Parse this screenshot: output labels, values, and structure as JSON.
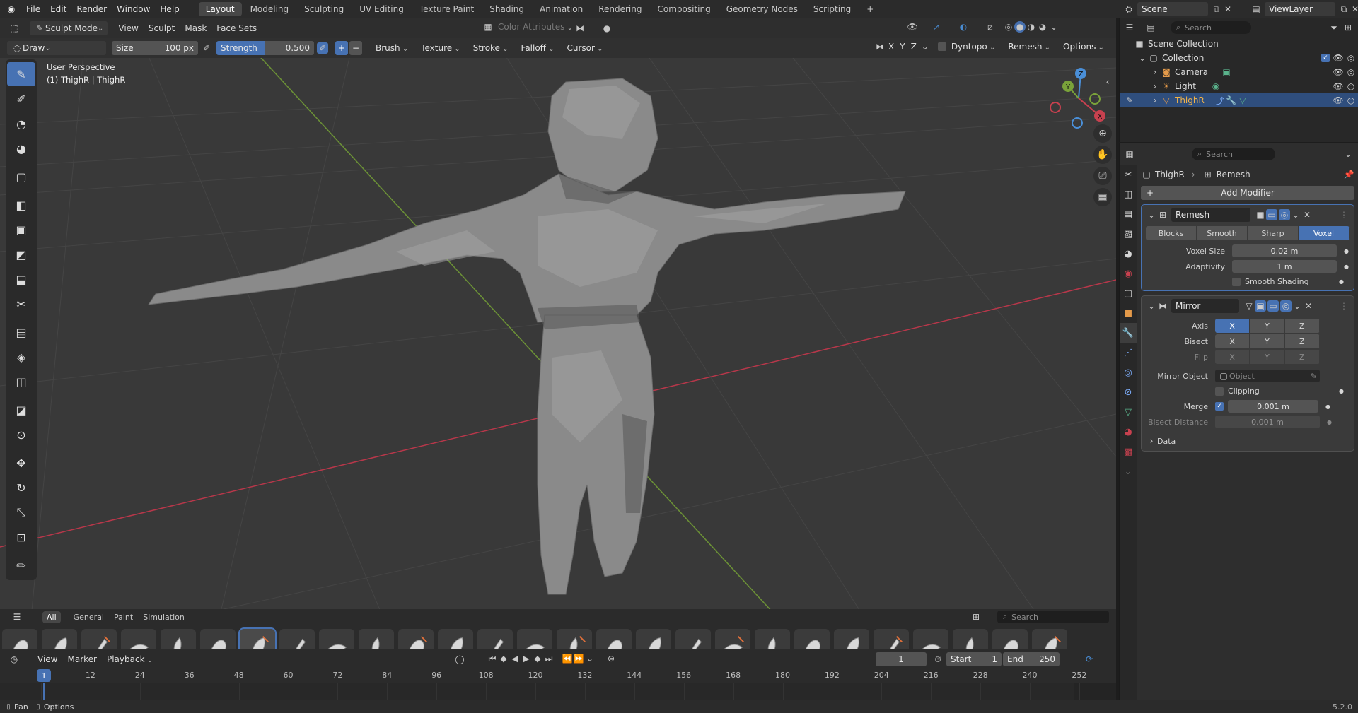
{
  "topbar": {
    "menus": [
      "File",
      "Edit",
      "Render",
      "Window",
      "Help"
    ],
    "workspaces": [
      "Layout",
      "Modeling",
      "Sculpting",
      "UV Editing",
      "Texture Paint",
      "Shading",
      "Animation",
      "Rendering",
      "Compositing",
      "Geometry Nodes",
      "Scripting"
    ],
    "active_workspace": "Layout",
    "add_tab": "+",
    "scene": "Scene",
    "view_layer": "ViewLayer"
  },
  "viewport": {
    "mode": "Sculpt Mode",
    "menus": [
      "View",
      "Sculpt",
      "Mask",
      "Face Sets"
    ],
    "color_attributes": "Color Attributes",
    "overlay_text_1": "User Perspective",
    "overlay_text_2": "(1) ThighR | ThighR",
    "tool_settings": {
      "brush": "Draw",
      "size_label": "Size",
      "size_value": "100 px",
      "strength_label": "Strength",
      "strength_value": "0.500",
      "plus": "+",
      "minus": "−",
      "dropdowns": [
        "Brush",
        "Texture",
        "Stroke",
        "Falloff",
        "Cursor"
      ],
      "axes": [
        "X",
        "Y",
        "Z"
      ],
      "dyntopo": "Dyntopo",
      "remesh": "Remesh",
      "options": "Options"
    },
    "gizmo": {
      "x": "X",
      "y": "Y",
      "z": "Z"
    }
  },
  "shelf": {
    "tabs": [
      "All",
      "General",
      "Paint",
      "Simulation"
    ],
    "active_tab": "All",
    "search_placeholder": "Search",
    "brush_count": 27,
    "active_brush_index": 6
  },
  "timeline": {
    "menus": [
      "View",
      "Marker",
      "Playback"
    ],
    "current_frame": "1",
    "start_label": "Start",
    "start": "1",
    "end_label": "End",
    "end": "250",
    "ticks": [
      "1",
      "12",
      "24",
      "36",
      "48",
      "60",
      "72",
      "84",
      "96",
      "108",
      "120",
      "132",
      "144",
      "156",
      "168",
      "180",
      "192",
      "204",
      "216",
      "228",
      "240",
      "252"
    ]
  },
  "statusbar": {
    "pan": "Pan",
    "options": "Options",
    "version": "5.2.0"
  },
  "outliner": {
    "search_placeholder": "Search",
    "root": "Scene Collection",
    "collection": "Collection",
    "items": [
      {
        "name": "Camera",
        "icon": "camera-icon"
      },
      {
        "name": "Light",
        "icon": "light-icon"
      },
      {
        "name": "ThighR",
        "icon": "mesh-icon",
        "selected": true
      }
    ]
  },
  "properties": {
    "search_placeholder": "Search",
    "breadcrumb_object": "ThighR",
    "breadcrumb_sep": "›",
    "breadcrumb_modifier": "Remesh",
    "add_modifier": "Add Modifier",
    "remesh": {
      "name": "Remesh",
      "modes": [
        "Blocks",
        "Smooth",
        "Sharp",
        "Voxel"
      ],
      "active_mode": "Voxel",
      "voxel_size_label": "Voxel Size",
      "voxel_size": "0.02 m",
      "adaptivity_label": "Adaptivity",
      "adaptivity": "1 m",
      "smooth_shading": "Smooth Shading"
    },
    "mirror": {
      "name": "Mirror",
      "axis_label": "Axis",
      "bisect_label": "Bisect",
      "flip_label": "Flip",
      "axes": [
        "X",
        "Y",
        "Z"
      ],
      "mirror_object_label": "Mirror Object",
      "mirror_object_placeholder": "Object",
      "clipping": "Clipping",
      "merge_label": "Merge",
      "merge_value": "0.001 m",
      "bisect_distance_label": "Bisect Distance",
      "bisect_distance": "0.001 m",
      "data": "Data"
    }
  },
  "colors": {
    "accent": "#4772b3",
    "x_axis": "#c8414f",
    "y_axis": "#7aa23a",
    "z_axis": "#4a8fd8"
  }
}
